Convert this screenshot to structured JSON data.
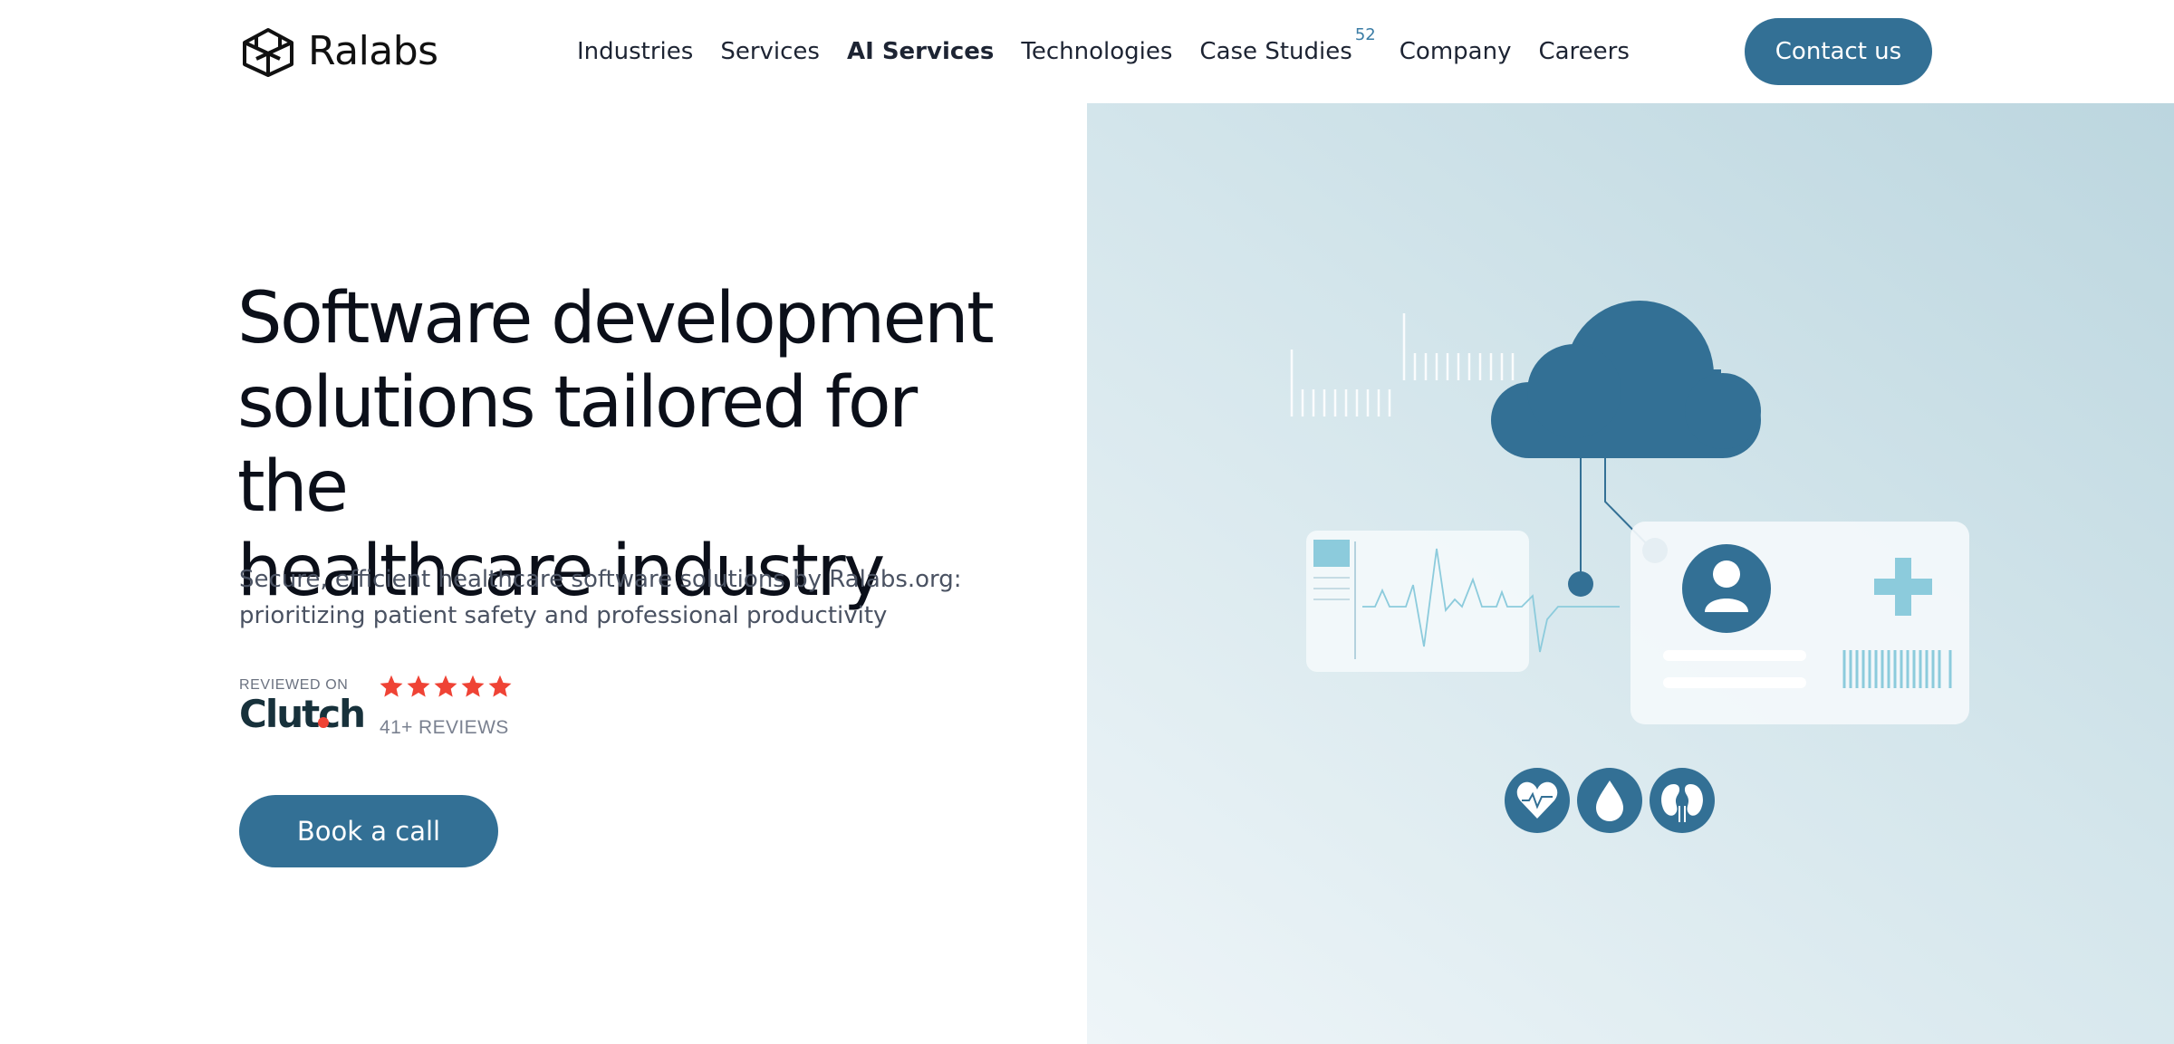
{
  "brand": {
    "name": "Ralabs",
    "logo_icon": "hexagon-cube-logo"
  },
  "nav": {
    "items": [
      {
        "label": "Industries"
      },
      {
        "label": "Services"
      },
      {
        "label": "AI Services"
      },
      {
        "label": "Technologies"
      },
      {
        "label": "Case Studies",
        "badge": "52"
      },
      {
        "label": "Company"
      },
      {
        "label": "Careers"
      }
    ],
    "contact_label": "Contact us"
  },
  "hero": {
    "title_lines": [
      "Software development",
      "solutions tailored for the",
      "healthcare industry"
    ],
    "subtitle_lines": [
      "Secure, efficient healthcare software solutions by Ralabs.org:",
      "prioritizing patient safety and professional productivity"
    ],
    "review_label": "REVIEWED ON",
    "review_platform": "Clutch",
    "rating": 5,
    "review_count": "41+ REVIEWS",
    "cta_label": "Book a call"
  },
  "illustration": {
    "icons": [
      "cloud-icon",
      "ecg-chart-icon",
      "patient-avatar-icon",
      "medical-cross-icon",
      "barcode-icon",
      "heart-icon",
      "blood-drop-icon",
      "kidney-icon"
    ]
  },
  "colors": {
    "primary": "#337095",
    "accent_light": "#8ccbdc",
    "star": "#ef4335",
    "panel_start": "#bcd6df",
    "panel_end": "#eef5f8"
  }
}
